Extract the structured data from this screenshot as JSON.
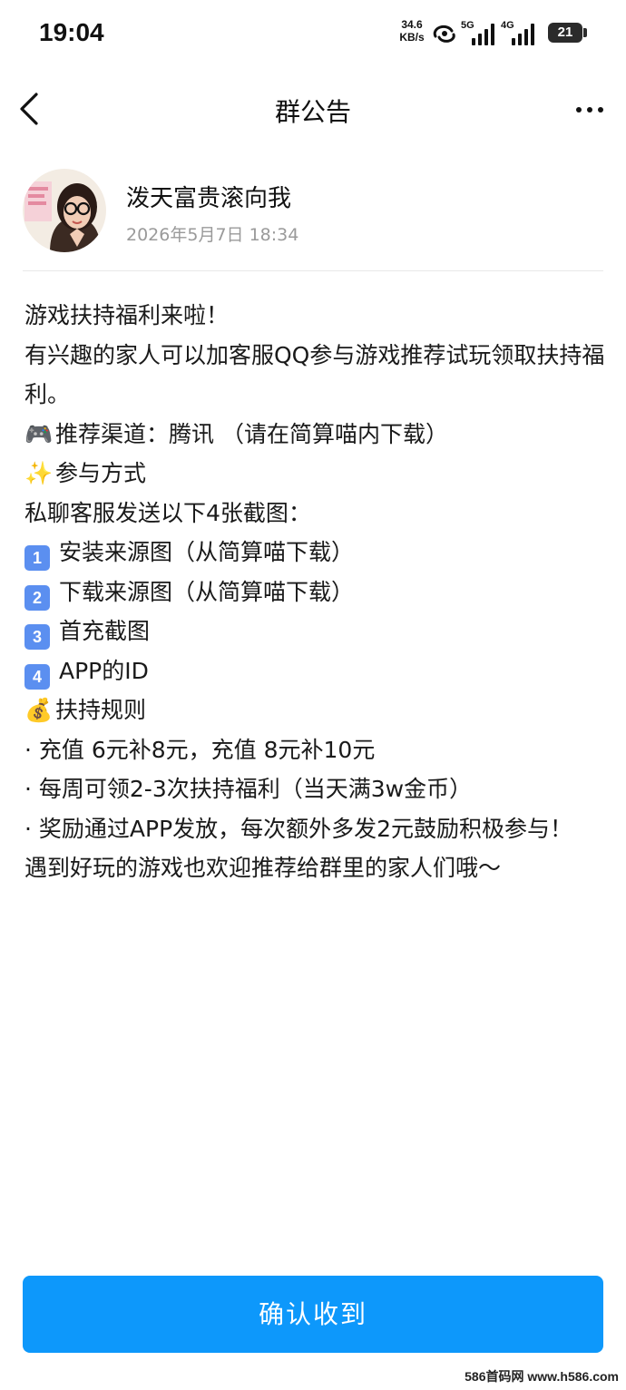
{
  "status_bar": {
    "time": "19:04",
    "net_speed_value": "34.6",
    "net_speed_unit": "KB/s",
    "signal_1_label": "5G",
    "signal_2_label": "4G",
    "battery": "21"
  },
  "nav": {
    "title": "群公告",
    "back_icon": "chevron-left-icon",
    "more_icon": "more-dots-icon"
  },
  "author": {
    "name": "泼天富贵滚向我",
    "time": "2026年5月7日 18:34"
  },
  "notice": {
    "lines": [
      "游戏扶持福利来啦！",
      "有兴趣的家人可以加客服QQ参与游戏推荐试玩领取扶持福利。",
      "推荐渠道：腾讯 （请在简算喵内下载）",
      "参与方式",
      "私聊客服发送以下4张截图：",
      "安装来源图（从简算喵下载）",
      "下载来源图（从简算喵下载）",
      "首充截图",
      "APP的ID",
      "扶持规则",
      "· 充值 6元补8元，充值 8元补10元",
      "· 每周可领2-3次扶持福利（当天满3w金币）",
      "· 奖励通过APP发放，每次额外多发2元鼓励积极参与！",
      "遇到好玩的游戏也欢迎推荐给群里的家人们哦～"
    ],
    "emoji": {
      "game": "🎮",
      "sparkles": "✨",
      "money": "💰"
    },
    "keycaps": [
      "1",
      "2",
      "3",
      "4"
    ]
  },
  "confirm_button": {
    "label": "确认收到",
    "color": "#0d98fb"
  },
  "watermark": "586首码网 www.h586.com"
}
